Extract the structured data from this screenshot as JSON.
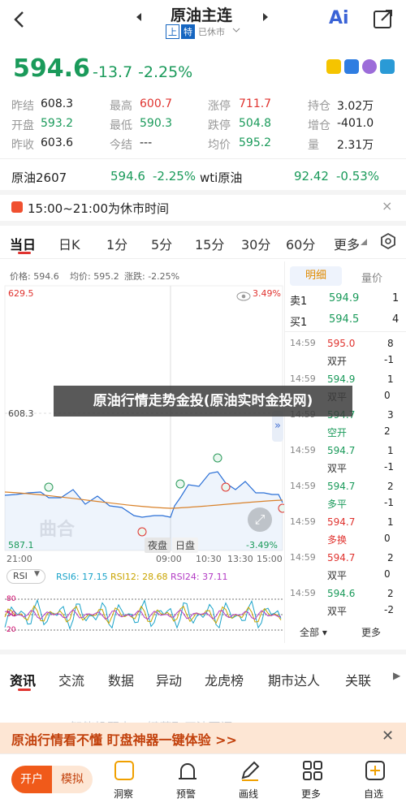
{
  "header": {
    "title": "原油主连",
    "sub_badges": [
      "上",
      "特"
    ],
    "market_status": "已休市",
    "ai_label": "Ai"
  },
  "price": {
    "last": "594.6",
    "change": "-13.7",
    "pct": "-2.25%"
  },
  "stats": [
    {
      "k": "昨结",
      "v": "608.3",
      "c": "#222"
    },
    {
      "k": "最高",
      "v": "600.7",
      "c": "#e0332f"
    },
    {
      "k": "涨停",
      "v": "711.7",
      "c": "#e0332f"
    },
    {
      "k": "持仓",
      "v": "3.02万",
      "c": "#222"
    },
    {
      "k": "开盘",
      "v": "593.2",
      "c": "#1a9a5a"
    },
    {
      "k": "最低",
      "v": "590.3",
      "c": "#1a9a5a"
    },
    {
      "k": "跌停",
      "v": "504.8",
      "c": "#1a9a5a"
    },
    {
      "k": "增仓",
      "v": "-401.0",
      "c": "#222"
    },
    {
      "k": "昨收",
      "v": "603.6",
      "c": "#222"
    },
    {
      "k": "今结",
      "v": "---",
      "c": "#222"
    },
    {
      "k": "均价",
      "v": "595.2",
      "c": "#1a9a5a"
    },
    {
      "k": "量",
      "v": "2.31万",
      "c": "#222"
    }
  ],
  "related": {
    "name": "原油2607",
    "price": "594.6",
    "pct": "-2.25%",
    "name2": "wti原油",
    "price2": "92.42",
    "pct2": "-0.53%"
  },
  "notice": "15:00~21:00为休市时间",
  "tabs": [
    "当日",
    "日K",
    "1分",
    "5分",
    "15分",
    "30分",
    "60分",
    "更多"
  ],
  "chart": {
    "info_price": "价格: 594.6",
    "info_avg": "均价: 595.2",
    "info_chg": "涨跌: -2.25%",
    "y_top": "629.5",
    "y_mid": "608.3",
    "y_bot": "587.1",
    "pct_top": "3.49%",
    "pct_bot": "-3.49%",
    "x_labels": [
      "21:00",
      "09:00",
      "10:30",
      "13:30",
      "15:00"
    ],
    "session_btns": [
      "夜盘",
      "日盘"
    ],
    "watermark": "曲合"
  },
  "rsi": {
    "label": "RSI",
    "rsi6": "RSI6: 17.15",
    "rsi12": "RSI12: 28.68",
    "rsi24": "RSI24: 37.11",
    "levels": [
      "80",
      "50",
      "20"
    ]
  },
  "orderbook": {
    "tabs": [
      "明细",
      "量价"
    ],
    "asks": [
      {
        "l": "卖1",
        "p": "594.9",
        "q": "1"
      }
    ],
    "bids": [
      {
        "l": "买1",
        "p": "594.5",
        "q": "4"
      }
    ],
    "trades": [
      {
        "t": "14:59",
        "p": "595.0",
        "pc": "#e0332f",
        "q": "8",
        "a": "双开",
        "ac": "#333",
        "d": "-1"
      },
      {
        "t": "14:59",
        "p": "594.9",
        "pc": "#1a9a5a",
        "q": "1",
        "a": "双平",
        "ac": "#333",
        "d": "0"
      },
      {
        "t": "14:59",
        "p": "594.7",
        "pc": "#1a9a5a",
        "q": "3",
        "a": "空开",
        "ac": "#1a9a5a",
        "d": "2"
      },
      {
        "t": "14:59",
        "p": "594.7",
        "pc": "#1a9a5a",
        "q": "1",
        "a": "双平",
        "ac": "#333",
        "d": "-1"
      },
      {
        "t": "14:59",
        "p": "594.7",
        "pc": "#1a9a5a",
        "q": "2",
        "a": "多平",
        "ac": "#1a9a5a",
        "d": "-1"
      },
      {
        "t": "14:59",
        "p": "594.7",
        "pc": "#e0332f",
        "q": "1",
        "a": "多换",
        "ac": "#e0332f",
        "d": "0"
      },
      {
        "t": "14:59",
        "p": "594.7",
        "pc": "#e0332f",
        "q": "2",
        "a": "双平",
        "ac": "#333",
        "d": "0"
      },
      {
        "t": "14:59",
        "p": "594.6",
        "pc": "#1a9a5a",
        "q": "2",
        "a": "双平",
        "ac": "#333",
        "d": "-2"
      }
    ],
    "all": "全部",
    "more": "更多"
  },
  "overlay_title": "原油行情走势金投(原油实时金投网)",
  "news_tabs": [
    "资讯",
    "交流",
    "数据",
    "异动",
    "龙虎榜",
    "期市达人",
    "关联"
  ],
  "ai_faded": "AI智能投顾中 一键获取原油要闻",
  "promo": "原油行情看不懂 盯盘神器一键体验 >>",
  "bottom": {
    "open": "开户",
    "demo": "模拟",
    "items": [
      "洞察",
      "预警",
      "画线",
      "更多",
      "自选"
    ]
  },
  "colors": {
    "up": "#e0332f",
    "down": "#1a9a5a",
    "accent": "#1565c0",
    "price_line": "#2a6fd6",
    "avg_line": "#d9822b"
  }
}
